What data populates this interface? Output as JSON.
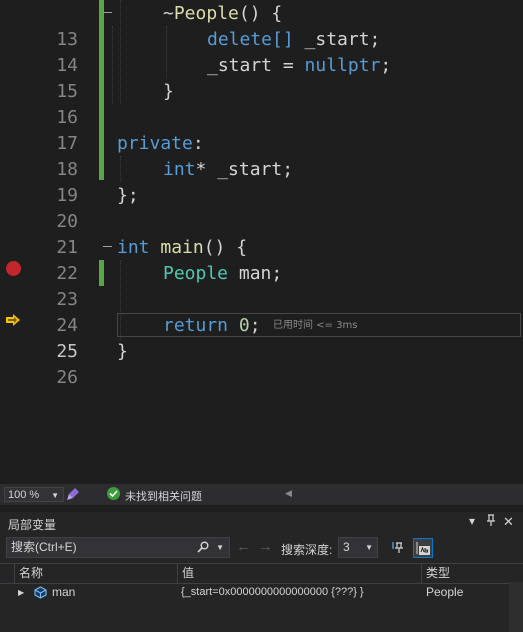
{
  "editor": {
    "lines": [
      {
        "num": "13"
      },
      {
        "num": "14"
      },
      {
        "num": "15"
      },
      {
        "num": "16"
      },
      {
        "num": "17"
      },
      {
        "num": "18"
      },
      {
        "num": "19"
      },
      {
        "num": "20"
      },
      {
        "num": "21"
      },
      {
        "num": "22"
      },
      {
        "num": "23"
      },
      {
        "num": "24"
      },
      {
        "num": "25"
      },
      {
        "num": "26"
      }
    ],
    "code": {
      "l13_tilde": "~",
      "l13_name": "People",
      "l13_rest": "() {",
      "l14_kw": "delete[]",
      "l14_rest": " _start;",
      "l15_var": "_start = ",
      "l15_kw": "nullptr",
      "l15_rest": ";",
      "l16": "}",
      "l18_kw": "private",
      "l18_rest": ":",
      "l19_kw": "int",
      "l19_rest": "* _start;",
      "l20": "};",
      "l22_kw": "int",
      "l22_fn": "main",
      "l22_rest": "() {",
      "l23_ty": "People",
      "l23_rest": " man;",
      "l25_kw": "return",
      "l25_num": "0",
      "l25_rest": ";",
      "l26": "}"
    },
    "perf_tip": "已用时间 <= 3ms",
    "colors": {
      "keyword": "#569cd6",
      "function": "#dcdcaa",
      "type": "#4ec9b0",
      "number": "#b5cea8",
      "change_bar": "#57a64a",
      "breakpoint": "#c3262d",
      "current_line_arrow": "#f5c400"
    }
  },
  "status": {
    "zoom": "100 %",
    "issues": "未找到相关问题"
  },
  "locals": {
    "title": "局部变量",
    "search_placeholder": "搜索(Ctrl+E)",
    "depth_label": "搜索深度:",
    "depth_value": "3",
    "columns": {
      "name": "名称",
      "value": "值",
      "type": "类型"
    },
    "rows": [
      {
        "name": "man",
        "value": "{_start=0x0000000000000000 {???} }",
        "type": "People"
      }
    ]
  }
}
